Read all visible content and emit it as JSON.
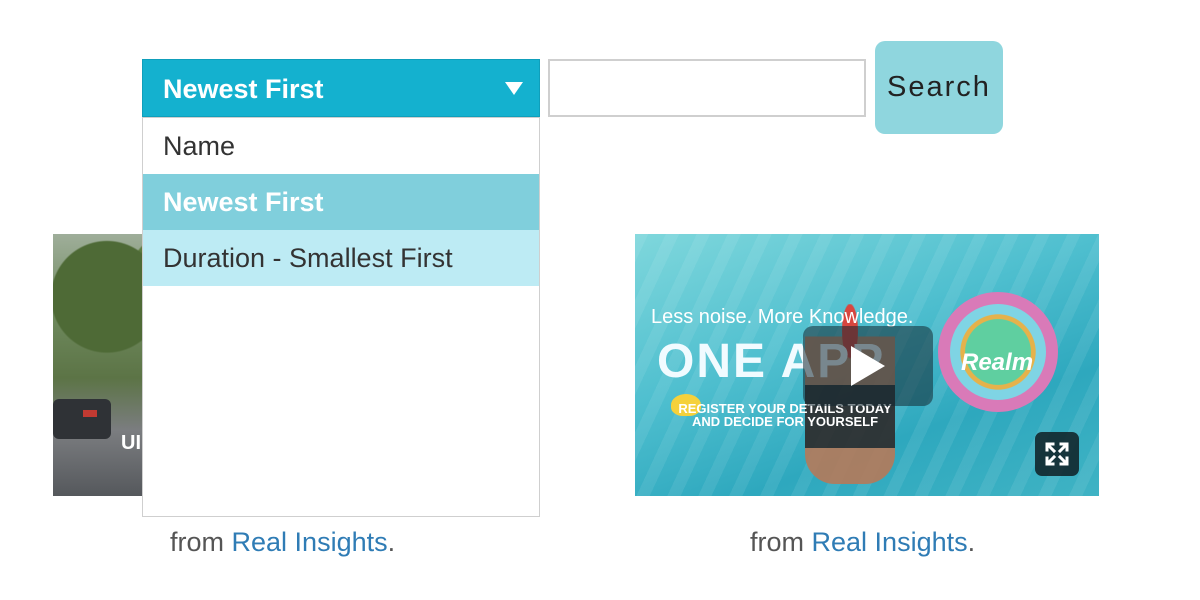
{
  "sort": {
    "selected": "Newest First",
    "options": [
      "Name",
      "Newest First",
      "Duration - Smallest First"
    ],
    "selected_index": 1,
    "hover_index": 2
  },
  "search": {
    "value": "",
    "placeholder": "",
    "button_label": "Search"
  },
  "videos": [
    {
      "overlay_text": "UI",
      "caption_prefix": "from ",
      "source_link": "Real Insights",
      "caption_suffix": "."
    },
    {
      "tagline": "Less noise. More Knowledge.",
      "headline": "ONE APP",
      "register_line1": "REGISTER YOUR DETAILS TODAY",
      "register_line2": "AND DECIDE FOR YOURSELF",
      "brand": "Realm",
      "caption_prefix": "from ",
      "source_link": "Real Insights",
      "caption_suffix": "."
    }
  ],
  "icons": {
    "caret": "chevron-down-icon",
    "play": "play-icon",
    "fullscreen": "fullscreen-icon"
  },
  "colors": {
    "select_bg": "#14b1cf",
    "option_selected": "#80cfdc",
    "option_hover": "#bdebf4",
    "search_button": "#8fd6de",
    "link": "#2f7cb5"
  }
}
